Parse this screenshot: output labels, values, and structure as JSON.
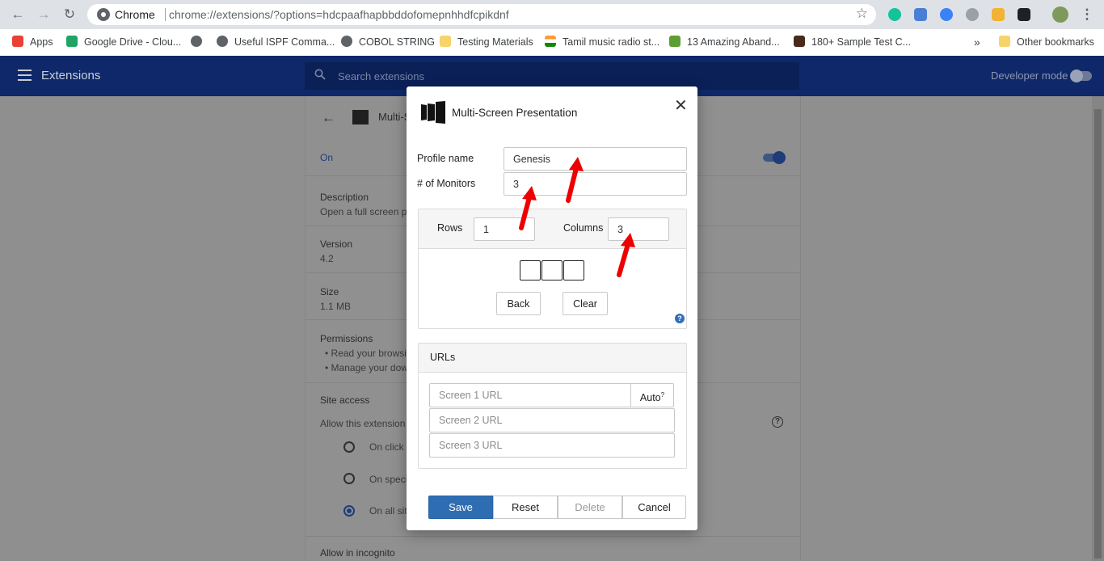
{
  "browser": {
    "omnibox_label": "Chrome",
    "url": "chrome://extensions/?options=hdcpaafhapbbddofomepnhhdfcpikdnf",
    "bookmarks": [
      {
        "label": "Apps",
        "icon": "apps-grid-icon",
        "color": "#e94235"
      },
      {
        "label": "Google Drive - Clou...",
        "icon": "google-drive-icon",
        "color": "#1fa463"
      },
      {
        "label": "",
        "icon": "globe-icon",
        "color": "#5f6368"
      },
      {
        "label": "Useful ISPF Comma...",
        "icon": "globe-icon",
        "color": "#5f6368"
      },
      {
        "label": "COBOL STRING",
        "icon": "globe-icon",
        "color": "#5f6368"
      },
      {
        "label": "Testing Materials",
        "icon": "folder-icon",
        "color": "#f6d36b"
      },
      {
        "label": "Tamil music radio st...",
        "icon": "india-flag-icon",
        "color": "#ff9933"
      },
      {
        "label": "13 Amazing Aband...",
        "icon": "dollar-icon",
        "color": "#5c9e31"
      },
      {
        "label": "180+ Sample Test C...",
        "icon": "site-icon",
        "color": "#4a2a1a"
      }
    ],
    "more_bookmarks": "»",
    "other_bookmarks": "Other bookmarks"
  },
  "extensions_page": {
    "title": "Extensions",
    "search_placeholder": "Search extensions",
    "developer_mode": "Developer mode",
    "ext_name_partial": "Multi-S",
    "on_label": "On",
    "description_label": "Description",
    "description_value": "Open a full screen pr",
    "version_label": "Version",
    "version_value": "4.2",
    "size_label": "Size",
    "size_value": "1.1 MB",
    "permissions_label": "Permissions",
    "permission_1": "Read your browsi",
    "permission_2": "Manage your dow",
    "site_access_label": "Site access",
    "allow_extension_label": "Allow this extension t",
    "site_options": [
      "On click",
      "On specifi",
      "On all site"
    ],
    "selected_site_option": 2,
    "incognito_label": "Allow in incognito"
  },
  "modal": {
    "title": "Multi-Screen Presentation",
    "profile_name_label": "Profile name",
    "profile_name_value": "Genesis",
    "monitors_label": "# of Monitors",
    "monitors_value": "3",
    "rows_label": "Rows",
    "rows_value": "1",
    "columns_label": "Columns",
    "columns_value": "3",
    "grid_cells": 3,
    "back_label": "Back",
    "clear_label": "Clear",
    "help_glyph": "?",
    "urls_title": "URLs",
    "url_placeholders": [
      "Screen 1 URL",
      "Screen 2 URL",
      "Screen 3 URL"
    ],
    "auto_label": "Auto",
    "auto_sup": "?",
    "save_label": "Save",
    "reset_label": "Reset",
    "delete_label": "Delete",
    "cancel_label": "Cancel"
  },
  "colors": {
    "header_bg": "#0e2869",
    "save_bg": "#2f6db3",
    "arrow_red": "#ee0000"
  }
}
